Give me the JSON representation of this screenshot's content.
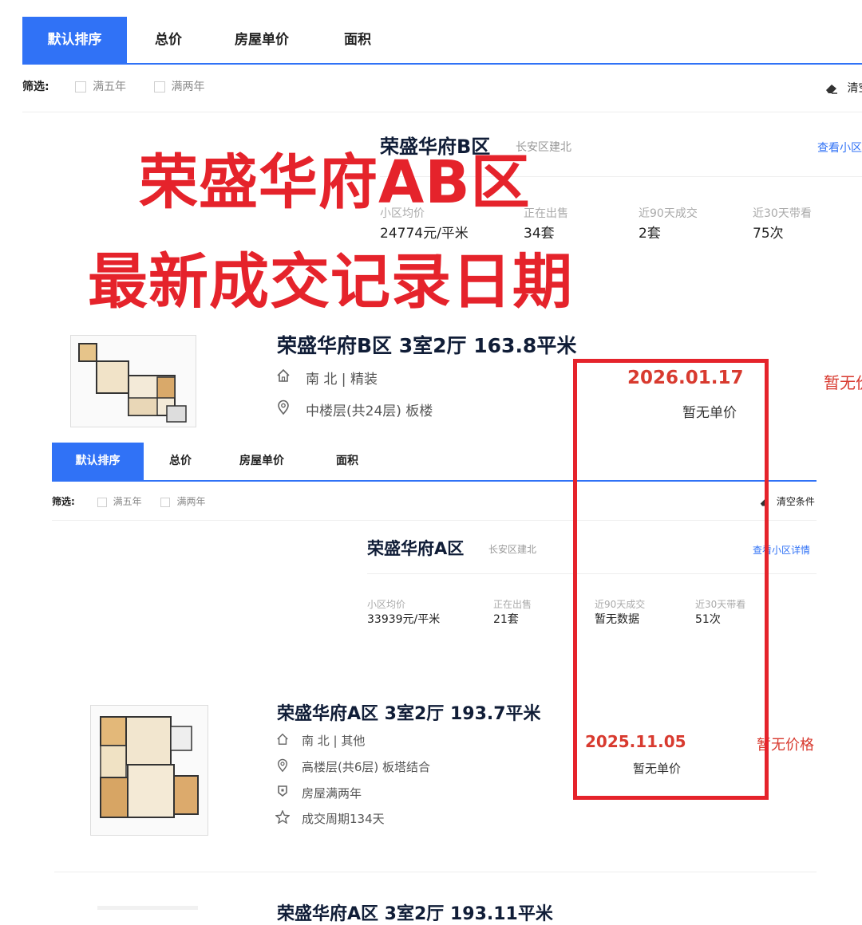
{
  "top": {
    "tabs": [
      "默认排序",
      "总价",
      "房屋单价",
      "面积"
    ],
    "filter_label": "筛选:",
    "filters": [
      "满五年",
      "满两年"
    ],
    "clear": "清空"
  },
  "community_b": {
    "name": "荣盛华府B区",
    "district": "长安区建北",
    "link": "查看小区",
    "stats": [
      {
        "label": "小区均价",
        "value": "24774元/平米"
      },
      {
        "label": "正在出售",
        "value": "34套"
      },
      {
        "label": "近90天成交",
        "value": "2套"
      },
      {
        "label": "近30天带看",
        "value": "75次"
      }
    ]
  },
  "overlay": {
    "line1": "荣盛华府AB区",
    "line2": "最新成交记录日期"
  },
  "listing_b": {
    "title": "荣盛华府B区 3室2厅 163.8平米",
    "orientation": "南 北 | 精装",
    "floor": "中楼层(共24层) 板楼",
    "date": "2026.01.17",
    "unit_price": "暂无单价",
    "price": "暂无价"
  },
  "second": {
    "tabs": [
      "默认排序",
      "总价",
      "房屋单价",
      "面积"
    ],
    "filter_label": "筛选:",
    "filters": [
      "满五年",
      "满两年"
    ],
    "clear": "清空条件"
  },
  "community_a": {
    "name": "荣盛华府A区",
    "district": "长安区建北",
    "link": "查看小区详情",
    "stats": [
      {
        "label": "小区均价",
        "value": "33939元/平米"
      },
      {
        "label": "正在出售",
        "value": "21套"
      },
      {
        "label": "近90天成交",
        "value": "暂无数据"
      },
      {
        "label": "近30天带看",
        "value": "51次"
      }
    ]
  },
  "listing_a": {
    "title": "荣盛华府A区 3室2厅 193.7平米",
    "orientation": "南 北 | 其他",
    "floor": "高楼层(共6层) 板塔结合",
    "tag1": "房屋满两年",
    "tag2": "成交周期134天",
    "date": "2025.11.05",
    "unit_price": "暂无单价",
    "price": "暂无价格"
  },
  "listing_next": {
    "title": "荣盛华府A区 3室2厅 193.11平米"
  },
  "colors": {
    "accent": "#3072f6",
    "highlight_red": "#e5232b",
    "date_red": "#d83a2f"
  }
}
